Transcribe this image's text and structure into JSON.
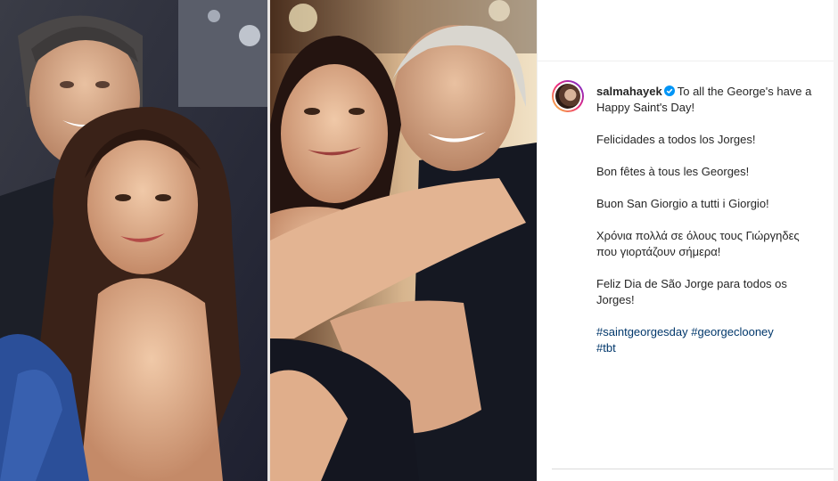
{
  "post": {
    "username": "salmahayek",
    "caption_line1": "To all the George's have a Happy Saint's Day!",
    "paragraphs": [
      "Felicidades a todos los Jorges!",
      "Bon fêtes à tous les Georges!",
      "Buon San Giorgio a tutti i Giorgio!",
      "Χρόνια πολλά σε όλους τους Γιώργηδες που γιορτάζουν σήμερα!",
      "Feliz Dia de São Jorge para todos os Jorges!"
    ],
    "hashtags": [
      "#saintgeorgesday",
      "#georgeclooney",
      "#tbt"
    ]
  },
  "icons": {
    "verified": "verified-badge-icon"
  },
  "colors": {
    "text": "#262626",
    "hashtag": "#00376b",
    "verified": "#0095f6"
  }
}
